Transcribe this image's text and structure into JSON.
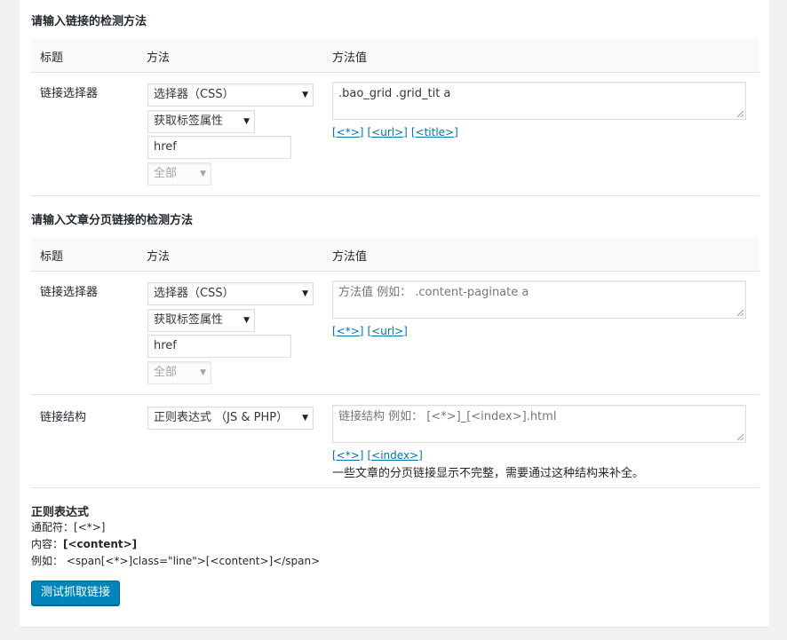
{
  "section1": {
    "title": "请输入链接的检测方法",
    "columns": [
      "标题",
      "方法",
      "方法值"
    ],
    "row": {
      "label": "链接选择器",
      "method_select": "选择器（CSS）",
      "attr_select": "获取标签属性",
      "attr_input": "href",
      "scope_select": "全部",
      "value": ".bao_grid .grid_tit a",
      "tokens": [
        "[<*>]",
        "[<url>]",
        "[<title>]"
      ]
    }
  },
  "section2": {
    "title": "请输入文章分页链接的检测方法",
    "columns": [
      "标题",
      "方法",
      "方法值"
    ],
    "row1": {
      "label": "链接选择器",
      "method_select": "选择器（CSS）",
      "attr_select": "获取标签属性",
      "attr_input": "href",
      "scope_select": "全部",
      "placeholder": "方法值 例如： .content-paginate a",
      "tokens": [
        "[<*>]",
        "[<url>]"
      ]
    },
    "row2": {
      "label": "链接结构",
      "method_select": "正则表达式 （JS & PHP）",
      "placeholder": "链接结构 例如： [<*>]_[<index>].html",
      "tokens": [
        "[<*>]",
        "[<index>]"
      ],
      "note": "一些文章的分页链接显示不完整，需要通过这种结构来补全。"
    }
  },
  "regex_help": {
    "title": "正则表达式",
    "wildcard_label": "通配符：",
    "wildcard_value": "[<*>]",
    "content_label": "内容：",
    "content_value": "[<content>]",
    "example_label": "例如：",
    "example_value": "<span[<*>]class=\"line\">[<content>]</span>"
  },
  "test_button": "测试抓取链接",
  "colors": {
    "accent": "#0085ba",
    "link": "#0073aa",
    "header_bg": "#f9f9f9",
    "page_bg": "#f1f1f1"
  }
}
